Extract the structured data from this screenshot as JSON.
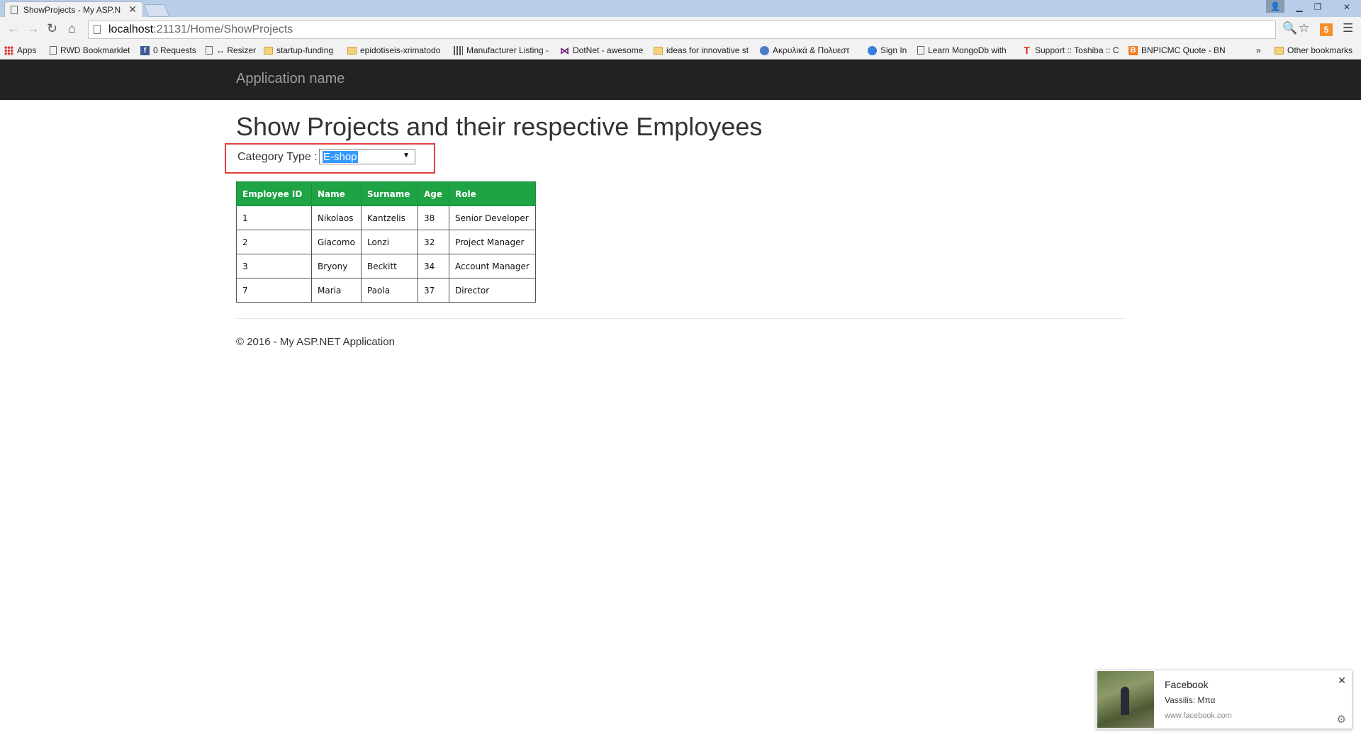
{
  "browser": {
    "tab_title": "ShowProjects - My ASP.N",
    "address_host": "localhost",
    "address_rest": ":21131/Home/ShowProjects",
    "bookmarks": [
      {
        "label": "Apps",
        "icon": "apps-grid-icon"
      },
      {
        "label": "RWD Bookmarklet",
        "icon": "page-icon"
      },
      {
        "label": "0 Requests",
        "icon": "facebook-icon"
      },
      {
        "label": "↔ Resizer",
        "icon": "page-icon"
      },
      {
        "label": "startup-funding",
        "icon": "folder-icon"
      },
      {
        "label": "epidotiseis-xrimatodo",
        "icon": "folder-icon"
      },
      {
        "label": "Manufacturer Listing -",
        "icon": "grid-icon"
      },
      {
        "label": "DotNet - awesome",
        "icon": "visual-studio-icon"
      },
      {
        "label": "ideas for innovative st",
        "icon": "folder-icon"
      },
      {
        "label": "Ακρυλικά & Πολυεστ",
        "icon": "globe-icon"
      },
      {
        "label": "Sign In",
        "icon": "signin-icon"
      },
      {
        "label": "Learn MongoDb with",
        "icon": "page-icon"
      },
      {
        "label": "Support :: Toshiba :: C",
        "icon": "toshiba-icon"
      },
      {
        "label": "BNPICMC Quote - BN",
        "icon": "blogger-icon"
      }
    ],
    "more_bookmarks": "»",
    "other_bookmarks": "Other bookmarks"
  },
  "navbar": {
    "brand": "Application name"
  },
  "main": {
    "title": "Show Projects and their respective Employees",
    "category_label": "Category Type :",
    "category_selected": "E-shop",
    "table": {
      "headers": [
        "Employee ID",
        "Name",
        "Surname",
        "Age",
        "Role"
      ],
      "rows": [
        [
          "1",
          "Nikolaos",
          "Kantzelis",
          "38",
          "Senior Developer"
        ],
        [
          "2",
          "Giacomo",
          "Lonzi",
          "32",
          "Project Manager"
        ],
        [
          "3",
          "Bryony",
          "Beckitt",
          "34",
          "Account Manager"
        ],
        [
          "7",
          "Maria",
          "Paola",
          "37",
          "Director"
        ]
      ]
    },
    "footer": "© 2016 - My ASP.NET Application"
  },
  "notification": {
    "title": "Facebook",
    "body": "Vassilis: Μπα",
    "source": "www.facebook.com"
  },
  "colors": {
    "table_header": "#1ea345",
    "highlight_box": "#e53e3e",
    "navbar": "#222222"
  }
}
